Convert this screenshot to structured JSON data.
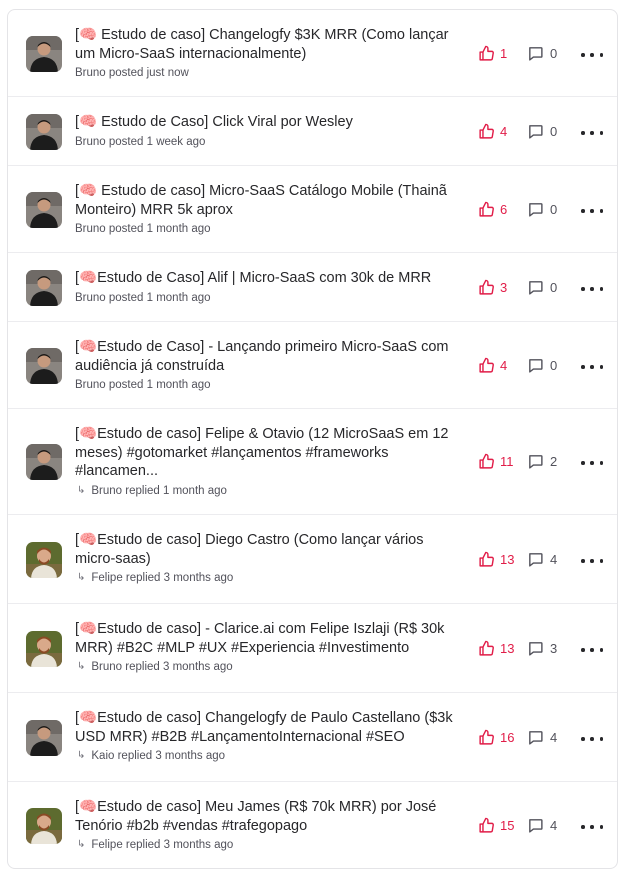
{
  "posts": [
    {
      "title": "[🧠 Estudo de caso] Changelogfy $3K MRR (Como lançar um Micro-SaaS internacionalmente)",
      "meta": "Bruno posted just now",
      "type": "posted",
      "avatar": "dark",
      "likes": "1",
      "comments": "0"
    },
    {
      "title": "[🧠 Estudo de Caso] Click Viral por Wesley",
      "meta": "Bruno posted 1 week ago",
      "type": "posted",
      "avatar": "dark",
      "likes": "4",
      "comments": "0"
    },
    {
      "title": "[🧠 Estudo de caso] Micro-SaaS Catálogo Mobile (Thainã Monteiro) MRR 5k aprox",
      "meta": "Bruno posted 1 month ago",
      "type": "posted",
      "avatar": "dark",
      "likes": "6",
      "comments": "0"
    },
    {
      "title": "[🧠Estudo de Caso] Alif | Micro-SaaS com 30k de MRR",
      "meta": "Bruno posted 1 month ago",
      "type": "posted",
      "avatar": "dark",
      "likes": "3",
      "comments": "0"
    },
    {
      "title": "[🧠Estudo de Caso] - Lançando primeiro Micro-SaaS com audiência já construída",
      "meta": "Bruno posted 1 month ago",
      "type": "posted",
      "avatar": "dark",
      "likes": "4",
      "comments": "0"
    },
    {
      "title": "[🧠Estudo de caso] Felipe & Otavio (12 MicroSaaS em 12 meses) #gotomarket #lançamentos #frameworks #lancamen...",
      "meta": "Bruno replied 1 month ago",
      "type": "replied",
      "avatar": "dark",
      "likes": "11",
      "comments": "2"
    },
    {
      "title": "[🧠Estudo de caso] Diego Castro (Como lançar vários micro-saas)",
      "meta": "Felipe replied 3 months ago",
      "type": "replied",
      "avatar": "light",
      "likes": "13",
      "comments": "4"
    },
    {
      "title": "[🧠Estudo de caso] - Clarice.ai com Felipe Iszlaji (R$ 30k MRR) #B2C #MLP #UX #Experiencia #Investimento",
      "meta": "Bruno replied 3 months ago",
      "type": "replied",
      "avatar": "light",
      "likes": "13",
      "comments": "3"
    },
    {
      "title": "[🧠Estudo de caso] Changelogfy de Paulo Castellano ($3k USD MRR) #B2B #LançamentoInternacional #SEO",
      "meta": "Kaio replied 3 months ago",
      "type": "replied",
      "avatar": "dark",
      "likes": "16",
      "comments": "4"
    },
    {
      "title": "[🧠Estudo de caso] Meu James (R$ 70k MRR) por José Tenório #b2b #vendas #trafegopago",
      "meta": "Felipe replied 3 months ago",
      "type": "replied",
      "avatar": "light",
      "likes": "15",
      "comments": "4"
    }
  ],
  "colors": {
    "like": "#e11d48",
    "text": "#27272a",
    "muted": "#52525b",
    "border": "#e4e4e7"
  },
  "icons": {
    "like": "thumbs-up-icon",
    "comment": "comment-icon",
    "more": "more-horizontal-icon",
    "reply": "reply-arrow-icon"
  }
}
